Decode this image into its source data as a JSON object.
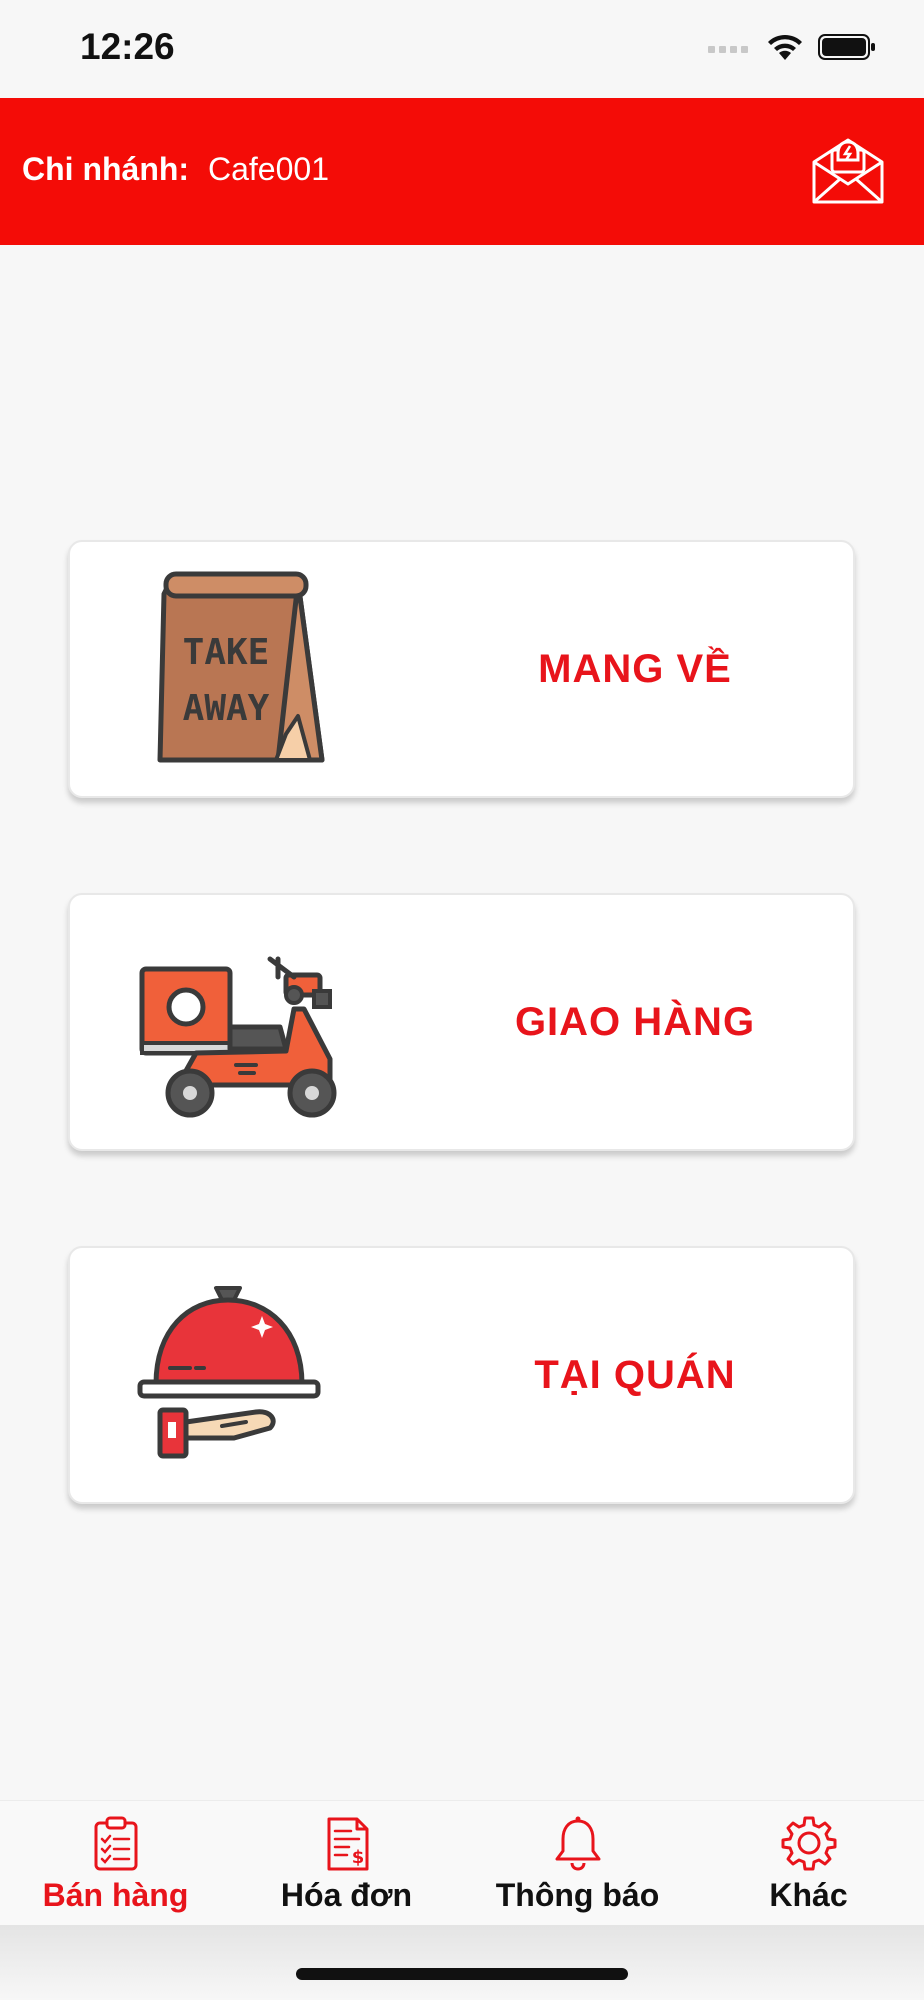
{
  "status_bar": {
    "time": "12:26"
  },
  "header": {
    "branch_label": "Chi nhánh:",
    "branch_value": "Cafe001",
    "notify_icon": "mail-notification-icon"
  },
  "cards": [
    {
      "label": "MANG VỀ",
      "icon": "takeaway-bag-icon",
      "bag_text_1": "TAKE",
      "bag_text_2": "AWAY"
    },
    {
      "label": "GIAO HÀNG",
      "icon": "delivery-scooter-icon"
    },
    {
      "label": "TẠI QUÁN",
      "icon": "cloche-serving-icon"
    }
  ],
  "tabs": [
    {
      "label": "Bán hàng",
      "icon": "clipboard-checklist-icon",
      "active": true
    },
    {
      "label": "Hóa đơn",
      "icon": "invoice-icon",
      "active": false
    },
    {
      "label": "Thông báo",
      "icon": "bell-icon",
      "active": false
    },
    {
      "label": "Khác",
      "icon": "gear-icon",
      "active": false
    }
  ],
  "colors": {
    "primary": "#f40c07",
    "accent_text": "#e8141b",
    "background": "#f7f7f7"
  }
}
